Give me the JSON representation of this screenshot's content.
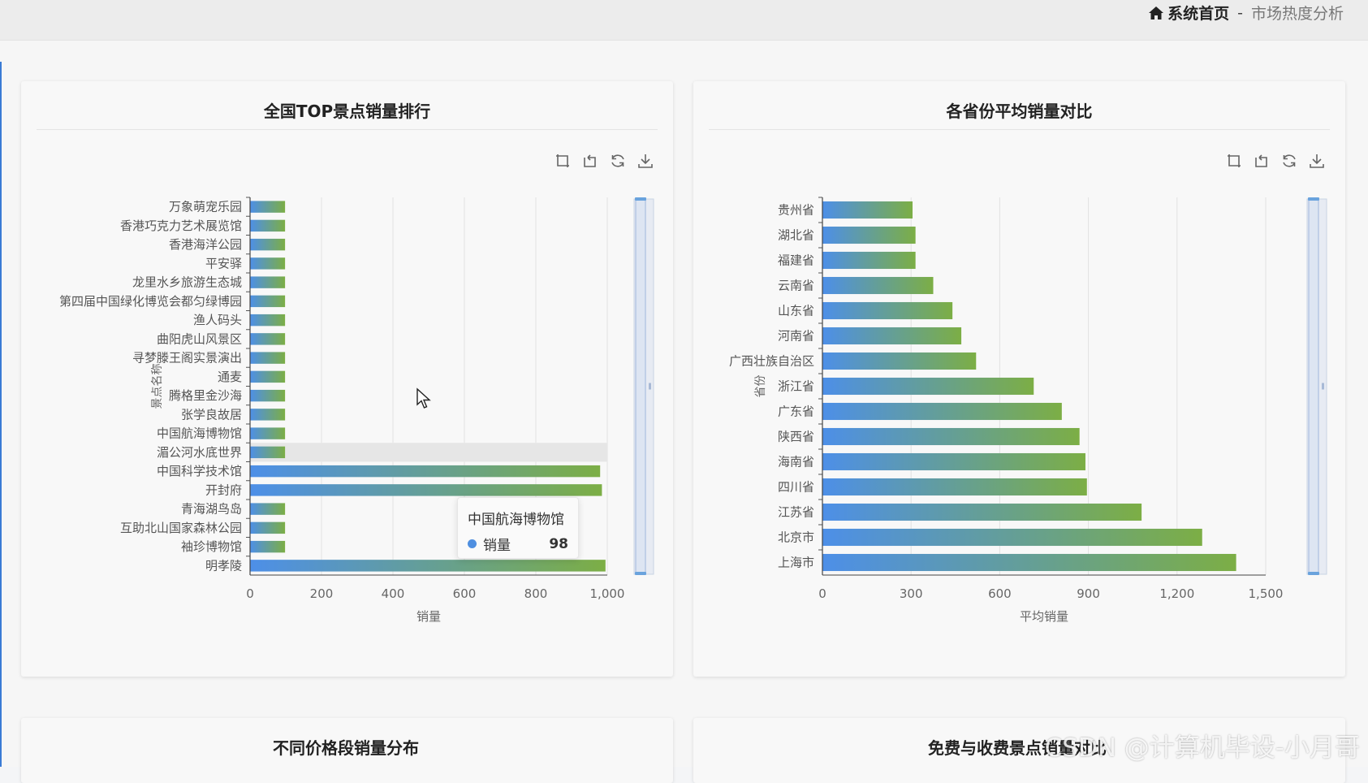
{
  "breadcrumb": {
    "home_label": "系统首页",
    "separator": "-",
    "current": "市场热度分析"
  },
  "toolbox_icons": [
    "zoom-select-icon",
    "zoom-reset-icon",
    "refresh-icon",
    "download-icon"
  ],
  "colors": {
    "bar_start": "#4d8fe8",
    "bar_end": "#7cae45",
    "tooltip_dot": "#4f8fe0"
  },
  "chart1": {
    "title": "全国TOP景点销量排行",
    "tooltip": {
      "name": "中国航海博物馆",
      "series": "销量",
      "value": "98"
    },
    "chart_data": {
      "type": "bar",
      "orientation": "horizontal",
      "categories": [
        "万象萌宠乐园",
        "香港巧克力艺术展览馆",
        "香港海洋公园",
        "平安驿",
        "龙里水乡旅游生态城",
        "第四届中国绿化博览会都匀绿博园",
        "渔人码头",
        "曲阳虎山风景区",
        "寻梦滕王阁实景演出",
        "通麦",
        "腾格里金沙海",
        "张学良故居",
        "中国航海博物馆",
        "湄公河水底世界",
        "中国科学技术馆",
        "开封府",
        "青海湖鸟岛",
        "互助北山国家森林公园",
        "袖珍博物馆",
        "明孝陵"
      ],
      "values": [
        98,
        98,
        98,
        98,
        98,
        98,
        98,
        98,
        98,
        98,
        98,
        98,
        98,
        98,
        980,
        985,
        98,
        98,
        98,
        995
      ],
      "xlabel": "销量",
      "ylabel": "景点名称",
      "xlim": [
        0,
        1000
      ],
      "xticks": [
        "0",
        "200",
        "400",
        "600",
        "800",
        "1,000"
      ],
      "grid": true
    }
  },
  "chart2": {
    "title": "各省份平均销量对比",
    "chart_data": {
      "type": "bar",
      "orientation": "horizontal",
      "categories": [
        "贵州省",
        "湖北省",
        "福建省",
        "云南省",
        "山东省",
        "河南省",
        "广西壮族自治区",
        "浙江省",
        "广东省",
        "陕西省",
        "海南省",
        "四川省",
        "江苏省",
        "北京市",
        "上海市"
      ],
      "values": [
        305,
        315,
        315,
        375,
        440,
        470,
        520,
        715,
        810,
        870,
        890,
        895,
        1080,
        1285,
        1400
      ],
      "xlabel": "平均销量",
      "ylabel": "省份",
      "xlim": [
        0,
        1500
      ],
      "xticks": [
        "0",
        "300",
        "600",
        "900",
        "1,200",
        "1,500"
      ],
      "grid": true
    }
  },
  "chart3": {
    "title": "不同价格段销量分布"
  },
  "chart4": {
    "title": "免费与收费景点销量对比"
  },
  "watermark": "CSDN @计算机毕设-小月哥"
}
